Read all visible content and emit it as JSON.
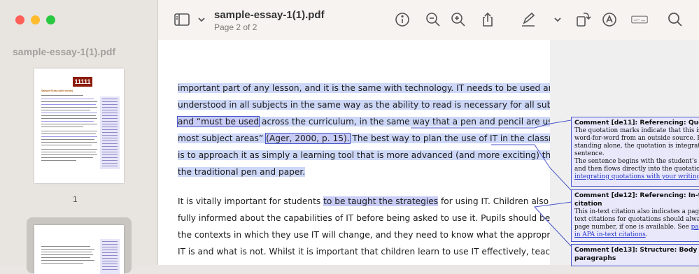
{
  "sidebar": {
    "title": "sample-essay-1(1).pdf",
    "thumbnails": [
      {
        "page_label": "1",
        "stamp": "11111",
        "heading": "Sample Essay (with words)"
      },
      {
        "page_label": ""
      }
    ]
  },
  "toolbar": {
    "doc_title": "sample-essay-1(1).pdf",
    "page_indicator": "Page 2 of 2",
    "icons": [
      "sidebar-toggle-icon",
      "chevron-down-icon",
      "info-icon",
      "zoom-out-icon",
      "zoom-in-icon",
      "share-icon",
      "markup-pen-icon",
      "chevron-down-icon",
      "rotate-icon",
      "markup-circle-icon",
      "signature-icon",
      "search-icon"
    ]
  },
  "page": {
    "para1": [
      {
        "text": "important part of any lesson, and it is the same with technology. IT needs to be used and"
      },
      {
        "text": "understood in all subjects in the same way as the ability to read is necessary for all subjects,"
      },
      {
        "pre": "and “must be used",
        "post": " across the curriculum, in the same way that a pen and pencil are used in"
      },
      {
        "pre": "most subject areas” ",
        "cite": "(Ager, 2000, p. 15).",
        "post": " The best way to plan the use of IT in the classroom"
      },
      {
        "text": "is to approach it as simply a learning tool that is more advanced (and more exciting) than"
      },
      {
        "text": "the traditional pen and paper."
      }
    ],
    "para2": [
      {
        "pre": "It is vitally important for students ",
        "hl": "to be taught the strategies",
        "post": " for using IT. Children also need to be"
      },
      {
        "text": "fully informed about the capabilities of IT before being asked to use it. Pupils should be aware that"
      },
      {
        "text": "the contexts in which they use IT will change, and they need to know what the appropriate use of"
      },
      {
        "text": "IT is and what is not. Whilst it is important that children learn to use IT effectively, teachers must"
      }
    ]
  },
  "comments": [
    {
      "title": "Comment [de11]:",
      "topic": " Referencing: Quotations",
      "lines": [
        "The quotation marks indicate that this is taken",
        "word-for-word from an outside source. Rather than",
        "standing alone, the quotation is integrated into the",
        "sentence.",
        "The sentence begins with the student’s own words",
        "and then flows directly into the quotation. See"
      ],
      "link": "integrating quotations with your writing",
      "link_suffix": "."
    },
    {
      "title": "Comment [de12]:",
      "topic": " Referencing: In-text",
      "topic2": "citation",
      "lines": [
        "This in-text citation also indicates a page number. In-",
        "text citations for quotations should always have a",
        "page number, if one is available. See "
      ],
      "link_pre": "page numbers",
      "link": "in APA in-text citations",
      "link_suffix": "."
    },
    {
      "title": "Comment [de13]:",
      "topic": " Structure: Body",
      "topic2": "paragraphs"
    }
  ]
}
